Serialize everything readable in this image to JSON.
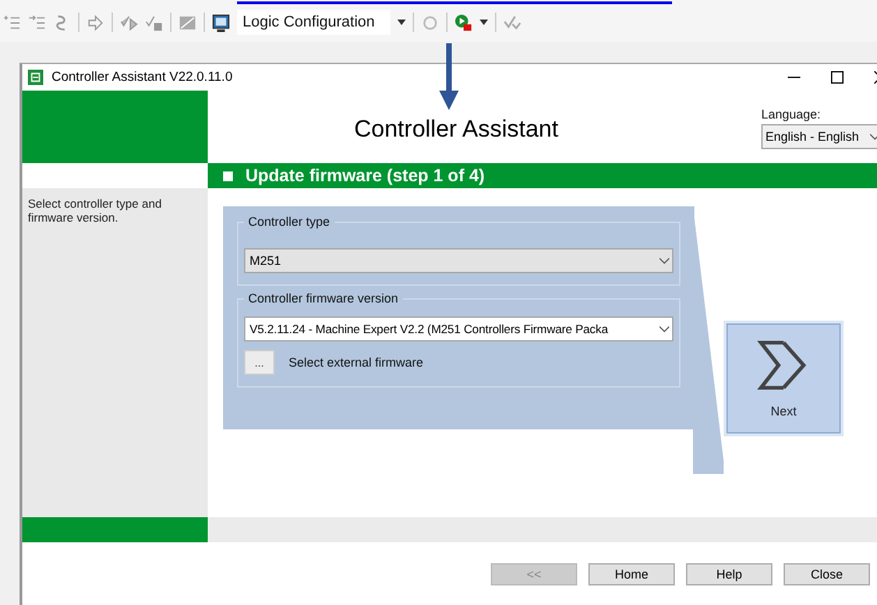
{
  "toolbar": {
    "mode_dropdown": "Logic Configuration"
  },
  "window": {
    "title": "Controller Assistant V22.0.11.0"
  },
  "header": {
    "title": "Controller Assistant",
    "language_label": "Language:",
    "language_value": "English - English"
  },
  "step": {
    "title": "Update firmware (step 1 of 4)"
  },
  "sidebar": {
    "hint": "Select controller type and firmware version."
  },
  "controller_type": {
    "label": "Controller type",
    "value": "M251",
    "disabled": true
  },
  "firmware": {
    "label": "Controller firmware version",
    "value": "V5.2.11.24 - Machine Expert V2.2 (M251 Controllers Firmware Packa",
    "disabled": false,
    "browse_button": "...",
    "browse_label": "Select external firmware"
  },
  "next_button": "Next",
  "buttons": [
    {
      "label": "<<",
      "disabled": true
    },
    {
      "label": "Home",
      "disabled": false
    },
    {
      "label": "Help",
      "disabled": false
    },
    {
      "label": "Close",
      "disabled": false
    }
  ]
}
